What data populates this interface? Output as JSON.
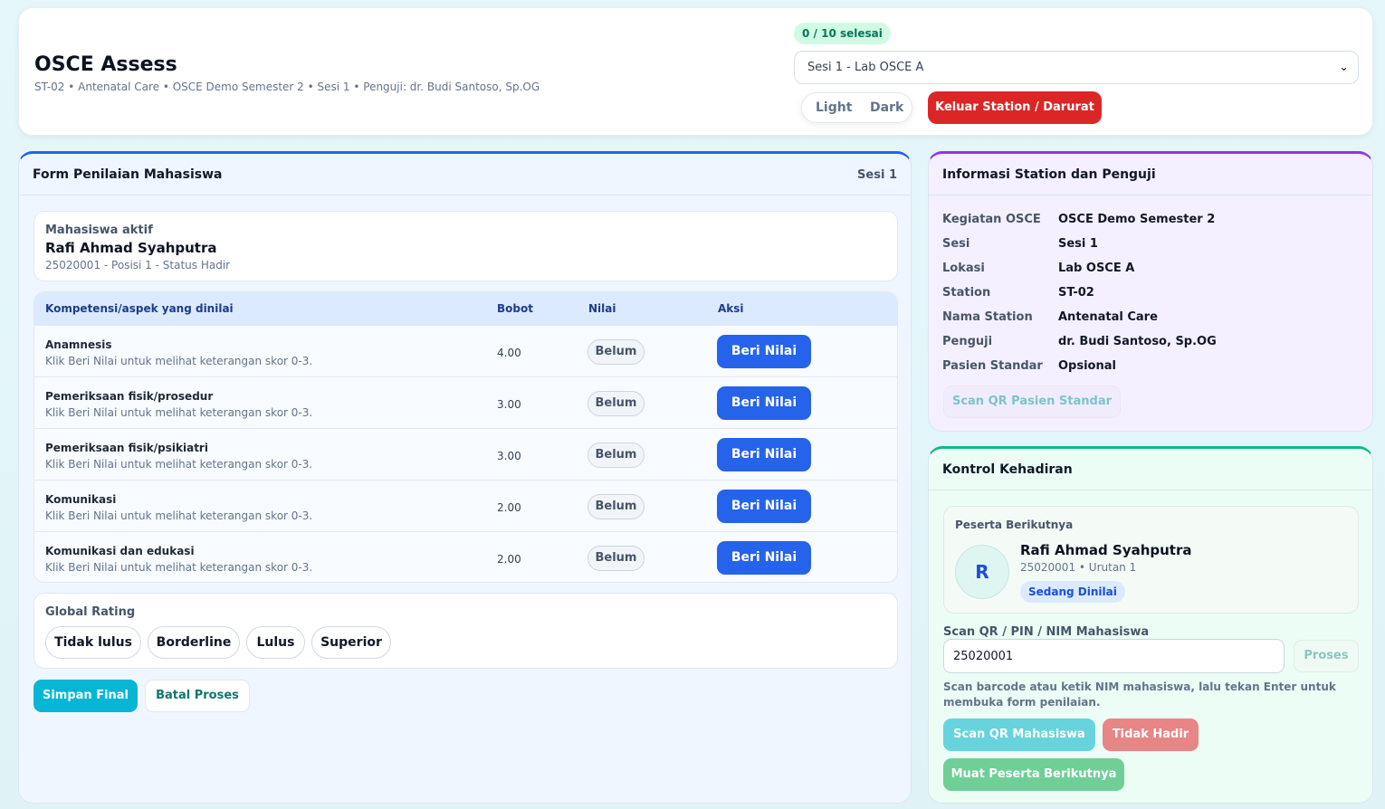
{
  "header": {
    "title": "OSCE Assess",
    "subtitle": "ST-02 • Antenatal Care • OSCE Demo Semester 2 • Sesi 1 • Penguji: dr. Budi Santoso, Sp.OG",
    "progress": "0 / 10 selesai",
    "session_select": "Sesi 1 - Lab OSCE A",
    "theme_light": "Light",
    "theme_dark": "Dark",
    "exit_button": "Keluar Station / Darurat"
  },
  "form": {
    "title": "Form Penilaian Mahasiswa",
    "session_label": "Sesi 1",
    "active_label": "Mahasiswa aktif",
    "student_name": "Rafi Ahmad Syahputra",
    "student_meta": "25020001 - Posisi 1 - Status Hadir",
    "columns": {
      "aspect": "Kompetensi/aspek yang dinilai",
      "weight": "Bobot",
      "score": "Nilai",
      "action": "Aksi"
    },
    "rows": [
      {
        "name": "Anamnesis",
        "hint": "Klik Beri Nilai untuk melihat keterangan skor 0-3.",
        "weight": "4.00",
        "status": "Belum",
        "action": "Beri Nilai"
      },
      {
        "name": "Pemeriksaan fisik/prosedur",
        "hint": "Klik Beri Nilai untuk melihat keterangan skor 0-3.",
        "weight": "3.00",
        "status": "Belum",
        "action": "Beri Nilai"
      },
      {
        "name": "Pemeriksaan fisik/psikiatri",
        "hint": "Klik Beri Nilai untuk melihat keterangan skor 0-3.",
        "weight": "3.00",
        "status": "Belum",
        "action": "Beri Nilai"
      },
      {
        "name": "Komunikasi",
        "hint": "Klik Beri Nilai untuk melihat keterangan skor 0-3.",
        "weight": "2.00",
        "status": "Belum",
        "action": "Beri Nilai"
      },
      {
        "name": "Komunikasi dan edukasi",
        "hint": "Klik Beri Nilai untuk melihat keterangan skor 0-3.",
        "weight": "2.00",
        "status": "Belum",
        "action": "Beri Nilai"
      }
    ],
    "global_rating": {
      "label": "Global Rating",
      "options": [
        "Tidak lulus",
        "Borderline",
        "Lulus",
        "Superior"
      ]
    },
    "save_button": "Simpan Final",
    "cancel_button": "Batal Proses"
  },
  "info": {
    "title": "Informasi Station dan Penguji",
    "rows": [
      {
        "key": "Kegiatan OSCE",
        "value": "OSCE Demo Semester 2"
      },
      {
        "key": "Sesi",
        "value": "Sesi 1"
      },
      {
        "key": "Lokasi",
        "value": "Lab OSCE A"
      },
      {
        "key": "Station",
        "value": "ST-02"
      },
      {
        "key": "Nama Station",
        "value": "Antenatal Care"
      },
      {
        "key": "Penguji",
        "value": "dr. Budi Santoso, Sp.OG"
      },
      {
        "key": "Pasien Standar",
        "value": "Opsional"
      }
    ],
    "scan_button": "Scan QR Pasien Standar"
  },
  "attendance": {
    "title": "Kontrol Kehadiran",
    "next_label": "Peserta Berikutnya",
    "avatar_initial": "R",
    "next_name": "Rafi Ahmad Syahputra",
    "next_meta": "25020001 • Urutan 1",
    "next_badge": "Sedang Dinilai",
    "scan_label": "Scan QR / PIN / NIM Mahasiswa",
    "scan_value": "25020001",
    "process_button": "Proses",
    "help_text": "Scan barcode atau ketik NIM mahasiswa, lalu tekan Enter untuk membuka form penilaian.",
    "scan_student_button": "Scan QR Mahasiswa",
    "absent_button": "Tidak Hadir",
    "load_next_button": "Muat Peserta Berikutnya"
  }
}
